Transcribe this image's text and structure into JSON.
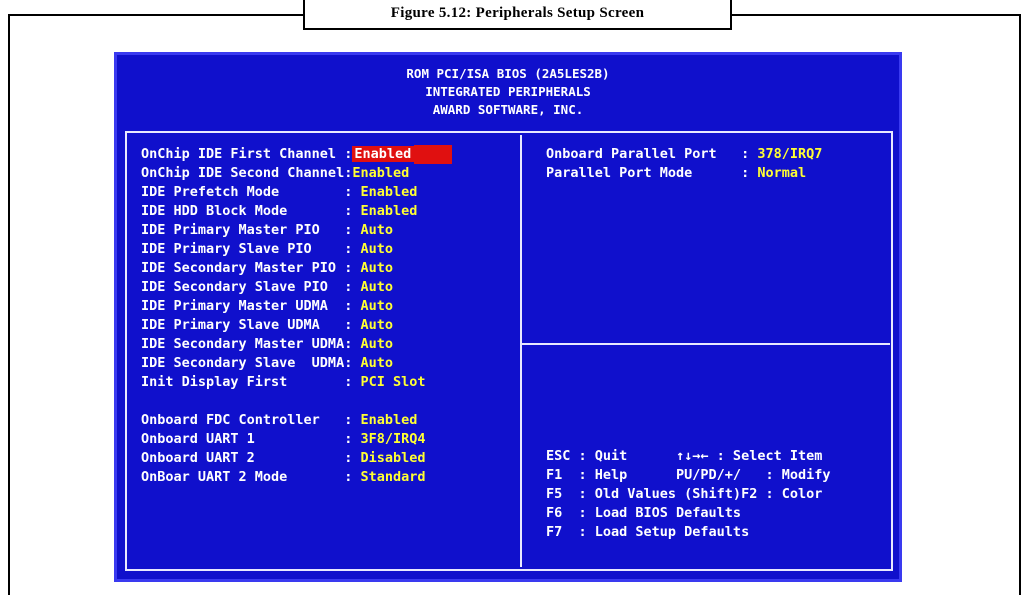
{
  "figure": {
    "caption": "Figure 5.12: Peripherals Setup Screen"
  },
  "bios": {
    "header_lines": [
      "ROM PCI/ISA BIOS (2A5LES2B)",
      "INTEGRATED PERIPHERALS",
      "AWARD SOFTWARE, INC."
    ],
    "left_settings": [
      {
        "label": "OnChip IDE First Channel :",
        "value": "Enabled",
        "selected": true
      },
      {
        "label": "OnChip IDE Second Channel:",
        "value": "Enabled"
      },
      {
        "label": "IDE Prefetch Mode        :",
        "value": "Enabled"
      },
      {
        "label": "IDE HDD Block Mode       :",
        "value": "Enabled"
      },
      {
        "label": "IDE Primary Master PIO   :",
        "value": "Auto"
      },
      {
        "label": "IDE Primary Slave PIO    :",
        "value": "Auto"
      },
      {
        "label": "IDE Secondary Master PIO :",
        "value": "Auto"
      },
      {
        "label": "IDE Secondary Slave PIO  :",
        "value": "Auto"
      },
      {
        "label": "IDE Primary Master UDMA  :",
        "value": "Auto"
      },
      {
        "label": "IDE Primary Slave UDMA   :",
        "value": "Auto"
      },
      {
        "label": "IDE Secondary Master UDMA:",
        "value": "Auto"
      },
      {
        "label": "IDE Secondary Slave  UDMA:",
        "value": "Auto"
      },
      {
        "label": "Init Display First       :",
        "value": "PCI Slot"
      },
      {
        "label": "Onboard FDC Controller   :",
        "value": "Enabled"
      },
      {
        "label": "Onboard UART 1           :",
        "value": "3F8/IRQ4"
      },
      {
        "label": "Onboard UART 2           :",
        "value": "Disabled"
      },
      {
        "label": "OnBoar UART 2 Mode       :",
        "value": "Standard"
      }
    ],
    "right_settings": [
      {
        "label": "Onboard Parallel Port   :",
        "value": "378/IRQ7"
      },
      {
        "label": "Parallel Port Mode      :",
        "value": "Normal"
      }
    ],
    "help_lines": [
      "ESC : Quit      ↑↓→← : Select Item",
      "F1  : Help      PU/PD/+/   : Modify",
      "F5  : Old Values (Shift)F2 : Color",
      "F6  : Load BIOS Defaults",
      "F7  : Load Setup Defaults"
    ],
    "colors": {
      "background": "#1010cc",
      "label": "#ffffff",
      "value": "#ffff33",
      "highlight": "#e01010"
    }
  }
}
